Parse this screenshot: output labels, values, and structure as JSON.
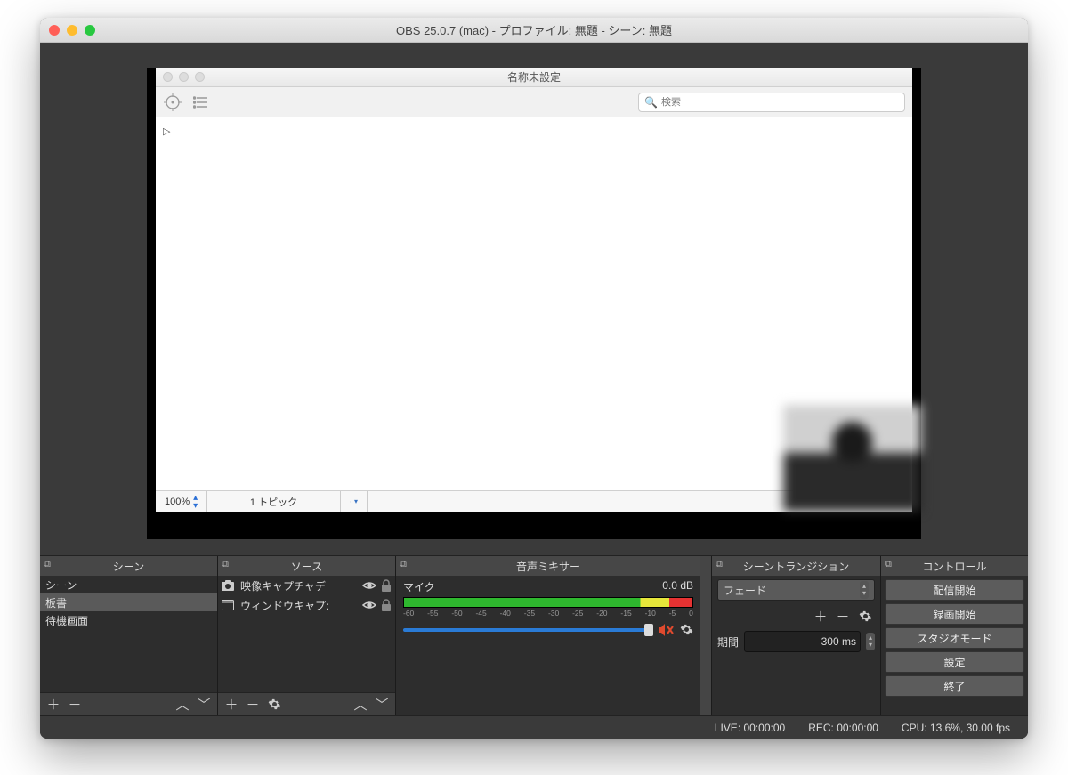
{
  "window": {
    "title": "OBS 25.0.7 (mac) - プロファイル: 無題 - シーン: 無題"
  },
  "preview": {
    "inner_title": "名称未設定",
    "search_placeholder": "検索",
    "footer_zoom": "100%",
    "footer_topic": "1 トピック"
  },
  "panels": {
    "scenes": {
      "title": "シーン",
      "items": [
        "シーン",
        "板書",
        "待機画面"
      ],
      "selected_index": 1
    },
    "sources": {
      "title": "ソース",
      "items": [
        {
          "icon": "camera",
          "label": "映像キャプチャデ"
        },
        {
          "icon": "window",
          "label": "ウィンドウキャプ:"
        }
      ]
    },
    "mixer": {
      "title": "音声ミキサー",
      "channel": "マイク",
      "db": "0.0 dB",
      "ticks": [
        "-60",
        "-55",
        "-50",
        "-45",
        "-40",
        "-35",
        "-30",
        "-25",
        "-20",
        "-15",
        "-10",
        "-5",
        "0"
      ]
    },
    "transitions": {
      "title": "シーントランジション",
      "selected": "フェード",
      "duration_label": "期間",
      "duration_value": "300 ms"
    },
    "controls": {
      "title": "コントロール",
      "buttons": [
        "配信開始",
        "録画開始",
        "スタジオモード",
        "設定",
        "終了"
      ]
    }
  },
  "status": {
    "live": "LIVE: 00:00:00",
    "rec": "REC: 00:00:00",
    "cpu": "CPU: 13.6%, 30.00 fps"
  }
}
